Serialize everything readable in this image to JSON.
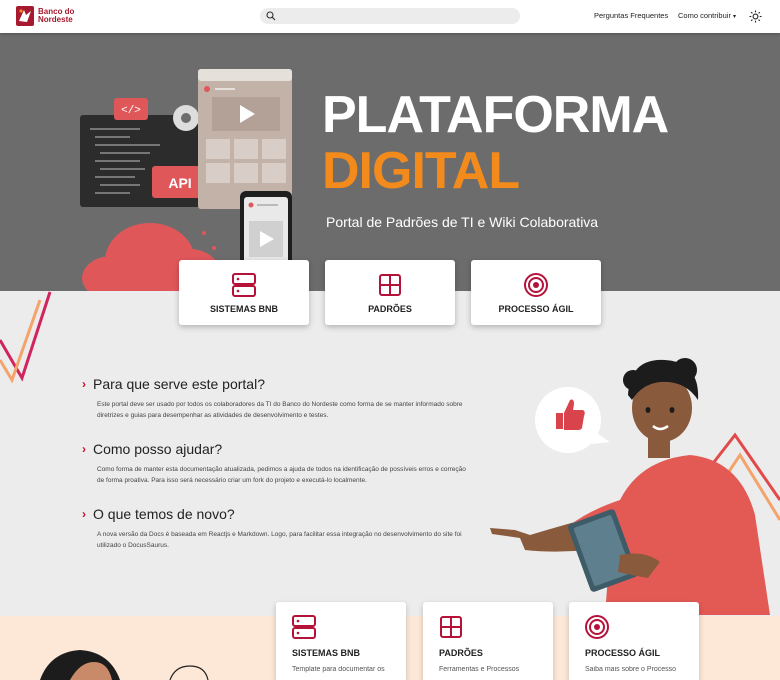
{
  "navbar": {
    "logo_line1": "Banco do",
    "logo_line2": "Nordeste",
    "faq_link": "Perguntas Frequentes",
    "contribute_link": "Como contribuir",
    "caret": "▾"
  },
  "hero": {
    "title_line1": "PLATAFORMA",
    "title_line2": "DIGITAL",
    "subtitle": "Portal de Padrões de TI e Wiki Colaborativa",
    "illustration_labels": {
      "code_tag": "</>",
      "api": "API"
    },
    "cards": [
      {
        "label": "SISTEMAS BNB",
        "icon": "server-icon"
      },
      {
        "label": "PADRÕES",
        "icon": "grid-icon"
      },
      {
        "label": "PROCESSO ÁGIL",
        "icon": "target-icon"
      }
    ]
  },
  "faq": [
    {
      "question": "Para que serve este portal?",
      "answer": "Este portal deve ser usado por todos os colaboradores da TI do Banco do Nordeste como forma de se manter informado sobre diretrizes e guias para desempenhar as atividades de desenvolvimento e testes."
    },
    {
      "question": "Como posso ajudar?",
      "answer": "Como forma de manter esta documentação atualizada, pedimos a ajuda de todos na identificação de possíveis erros e correção de forma proativa. Para isso será necessário criar um fork do projeto e executá-lo localmente."
    },
    {
      "question": "O que temos de novo?",
      "answer": "A nova versão da Docs é baseada em Reactjs e Markdown. Logo, para facilitar essa integração no desenvolvimento do site foi utilizado o DocusSaurus."
    }
  ],
  "bottom_cards": [
    {
      "title": "SISTEMAS BNB",
      "description": "Template para documentar os",
      "icon": "server-icon"
    },
    {
      "title": "PADRÕES",
      "description": "Ferramentas e Processos",
      "icon": "grid-icon"
    },
    {
      "title": "PROCESSO ÁGIL",
      "description": "Saiba mais sobre o Processo",
      "icon": "target-icon"
    }
  ],
  "colors": {
    "brand_red": "#a6192e",
    "accent_orange": "#f28a1c",
    "hero_bg": "#6d6c6c",
    "page_bg": "#ececec",
    "bottom_bg": "#fde8d7"
  }
}
